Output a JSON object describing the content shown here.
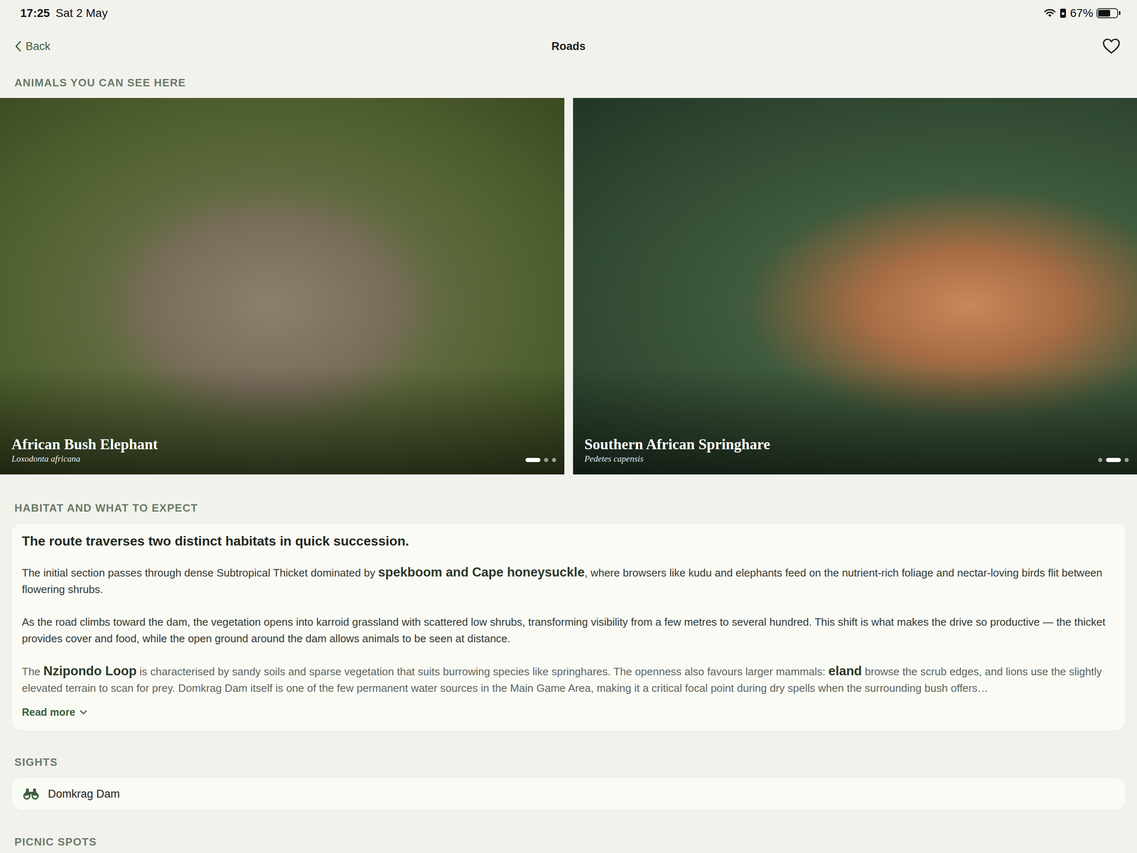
{
  "status_bar": {
    "time": "17:25",
    "date": "Sat 2 May",
    "battery": "67%",
    "battery_level": 0.67
  },
  "nav": {
    "back": "Back",
    "title": "Roads",
    "favorite": false
  },
  "animals": {
    "header": "ANIMALS YOU CAN SEE HERE",
    "items": [
      {
        "name": "African Bush Elephant",
        "latin": "Loxodonta africana",
        "pages": [
          {
            "selected": true
          },
          {
            "selected": false
          },
          {
            "selected": false
          }
        ]
      },
      {
        "name": "Southern African Springhare",
        "latin": "Pedetes capensis",
        "pages": [
          {
            "selected": false
          },
          {
            "selected": true
          },
          {
            "selected": false
          }
        ]
      }
    ]
  },
  "habitat": {
    "header": "HABITAT AND WHAT TO EXPECT",
    "title": "The route traverses two distinct habitats in quick succession.",
    "paragraphs": [
      {
        "faded": false,
        "segments": [
          {
            "text": "The initial section passes through dense Subtropical Thicket dominated by ",
            "bold": false
          },
          {
            "text": "spekboom and Cape honeysuckle",
            "bold": true
          },
          {
            "text": ", where browsers like kudu and elephants feed on the nutrient-rich foliage and nectar-loving birds flit between flowering shrubs.",
            "bold": false
          }
        ]
      },
      {
        "faded": false,
        "segments": [
          {
            "text": "As the road climbs toward the dam, the vegetation opens into karroid grassland with scattered low shrubs, transforming visibility from a few metres to several hundred. This shift is what makes the drive so productive — the thicket provides cover and food, while the open ground around the dam allows animals to be seen at distance.",
            "bold": false
          }
        ]
      },
      {
        "faded": true,
        "segments": [
          {
            "text": "The ",
            "bold": false
          },
          {
            "text": "Nzipondo Loop",
            "bold": true
          },
          {
            "text": " is characterised by sandy soils and sparse vegetation that suits burrowing species like springhares. The openness also favours larger mammals: ",
            "bold": false
          },
          {
            "text": "eland",
            "bold": true
          },
          {
            "text": " browse the scrub edges, and lions use the slightly elevated terrain to scan for prey. Domkrag Dam itself is one of the few permanent water sources in the Main Game Area, making it a critical focal point during dry spells when the surrounding bush offers…",
            "bold": false
          }
        ]
      }
    ],
    "read_more": {
      "label": "Read more",
      "expanded": false
    }
  },
  "sights": {
    "header": "SIGHTS",
    "items": [
      {
        "label": "Domkrag Dam"
      }
    ]
  },
  "picnic": {
    "header": "PICNIC SPOTS"
  }
}
